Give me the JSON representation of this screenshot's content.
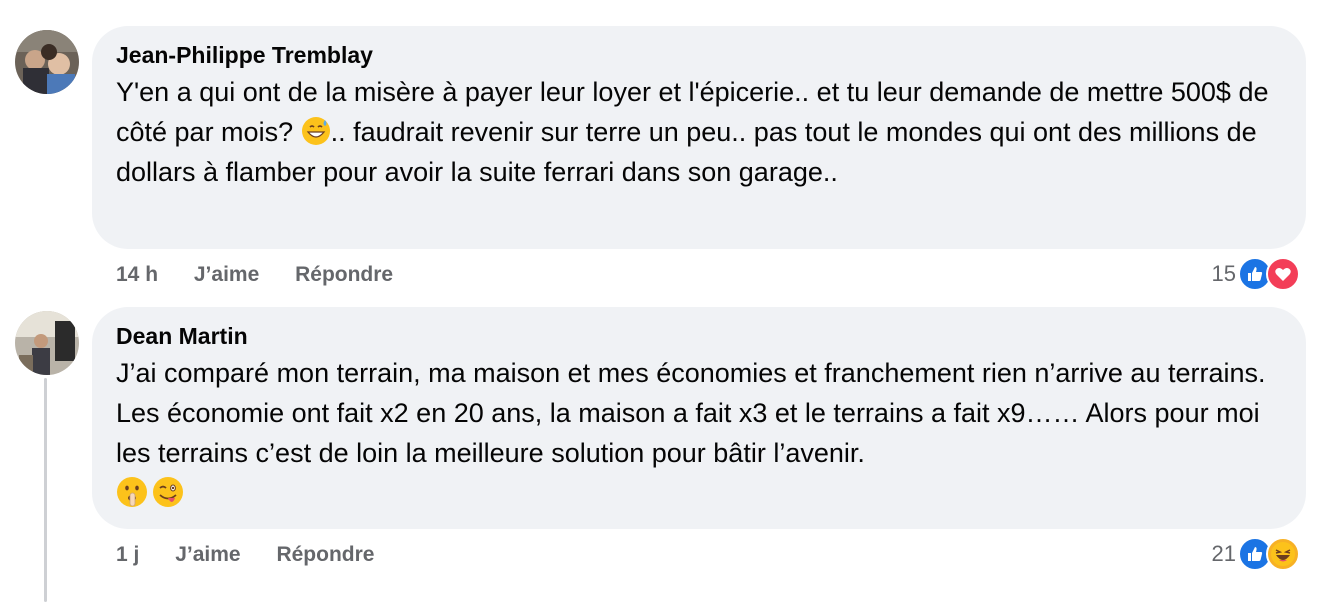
{
  "comments": [
    {
      "author": "Jean-Philippe Tremblay",
      "text_before_emoji": "Y'en a qui ont de la misère à payer leur loyer et l'épicerie.. et tu leur demande de mettre 500$ de côté par mois? ",
      "text_after_emoji": ".. faudrait revenir sur terre un peu.. pas tout le mondes qui ont des millions de dollars à flamber pour avoir la suite ferrari dans son garage..",
      "inline_emoji": "grinning-face-with-sweat",
      "time": "14 h",
      "like_label": "J’aime",
      "reply_label": "Répondre",
      "reaction_count": "15",
      "reactions": [
        "like",
        "love"
      ]
    },
    {
      "author": "Dean Martin",
      "text": "J’ai comparé mon terrain, ma maison et mes économies et franchement rien n’arrive au terrains. Les économie ont fait x2 en 20 ans, la maison a fait x3 et le terrains a fait x9…… Alors pour moi les terrains c’est de loin la meilleure solution pour bâtir l’avenir.",
      "trailing_emojis": [
        "shushing-face",
        "winking-face-with-tongue"
      ],
      "time": "1 j",
      "like_label": "J’aime",
      "reply_label": "Répondre",
      "reaction_count": "21",
      "reactions": [
        "like",
        "haha"
      ]
    }
  ],
  "colors": {
    "bubble_bg": "#f0f2f5",
    "meta_text": "#65676b",
    "like_blue": "#1b74e4",
    "love_red": "#f33e58",
    "haha_yellow": "#f7b125"
  }
}
